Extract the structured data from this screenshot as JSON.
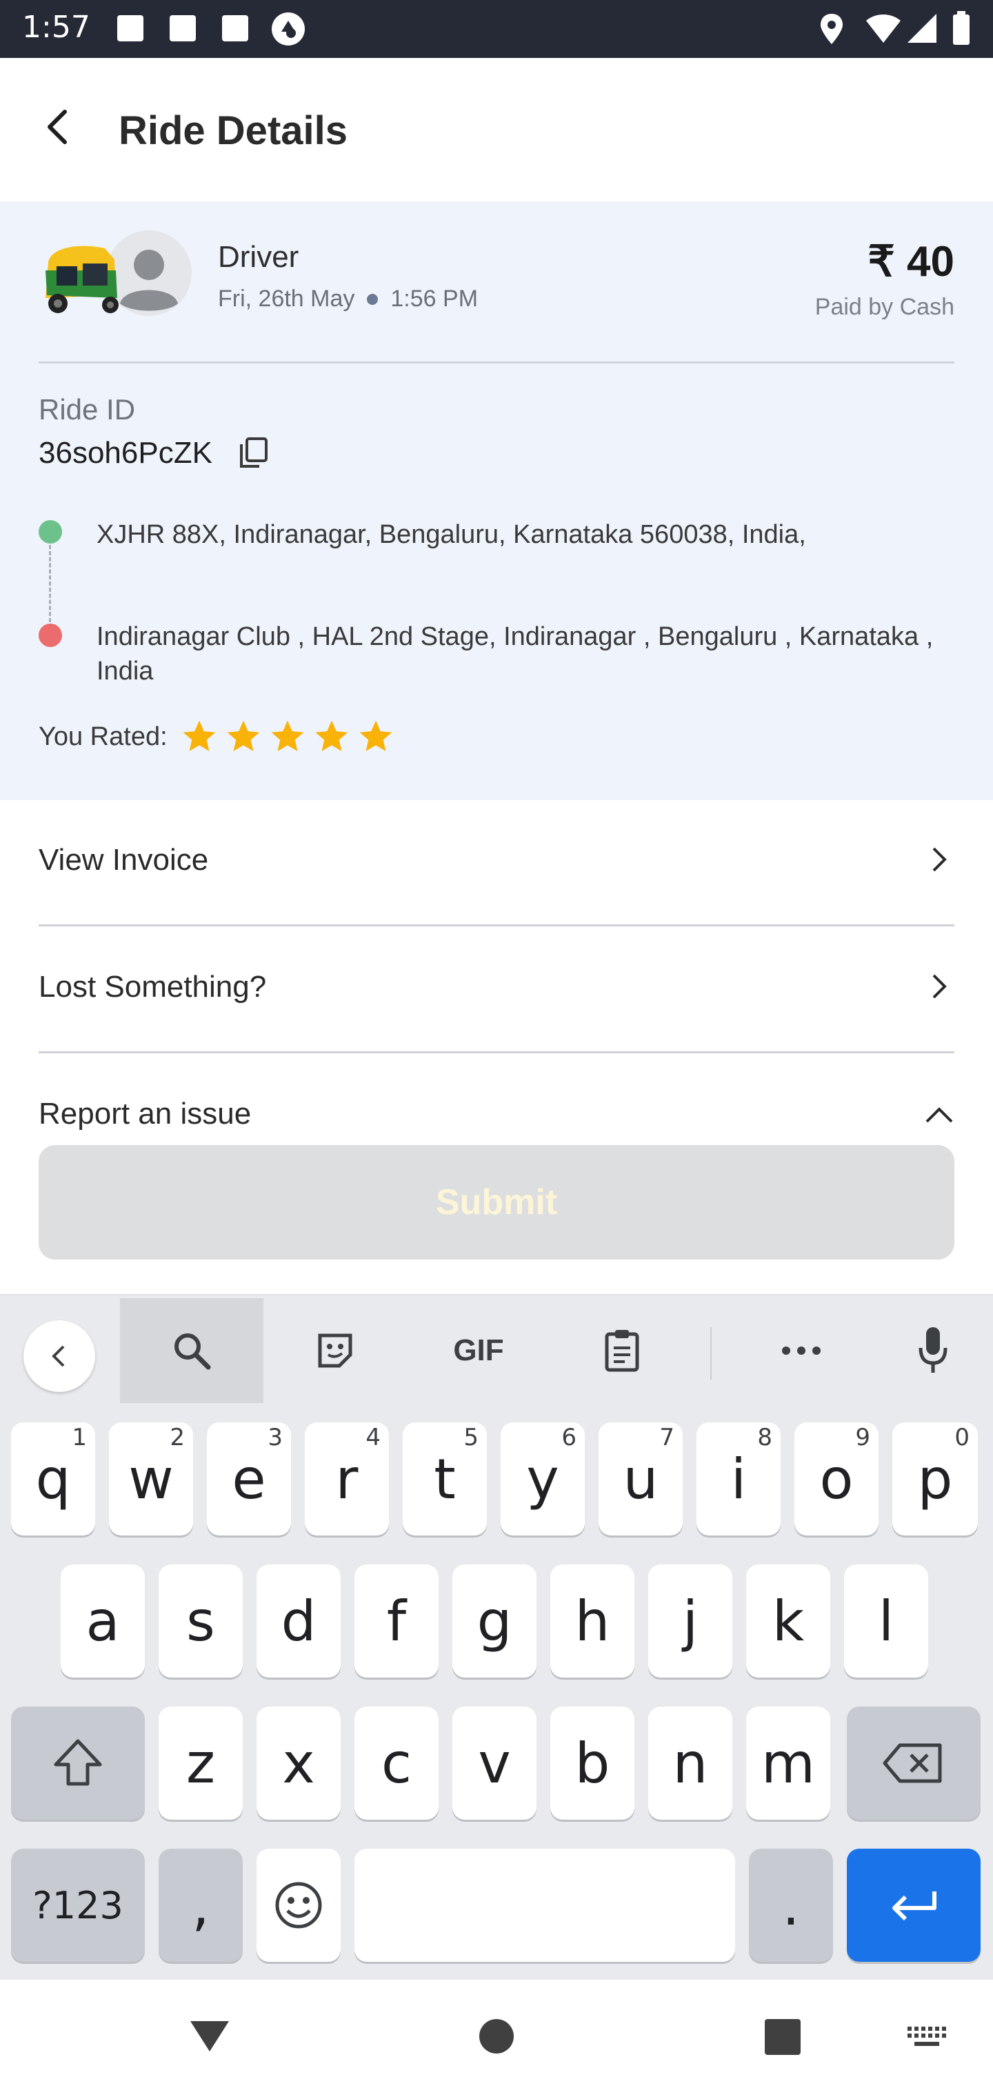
{
  "status_bar": {
    "time": "1:57",
    "left_icons": [
      "notification-square-icon",
      "notification-square-icon",
      "notification-square-icon",
      "app-circle-icon"
    ],
    "right_icons": [
      "location-icon",
      "wifi-icon",
      "signal-icon",
      "battery-icon"
    ]
  },
  "header": {
    "title": "Ride Details",
    "back_icon": "back-arrow-icon"
  },
  "ride": {
    "vehicle_icon": "auto-rickshaw-icon",
    "avatar_icon": "person-avatar-icon",
    "driver_label": "Driver",
    "date": "Fri, 26th May",
    "time": "1:56 PM",
    "fare": "₹ 40",
    "payment": "Paid by Cash",
    "ride_id_label": "Ride ID",
    "ride_id": "36soh6PcZK",
    "pickup": "XJHR 88X, Indiranagar, Bengaluru, Karnataka 560038, India,",
    "drop": "Indiranagar Club , HAL 2nd Stage, Indiranagar , Bengaluru , Karnataka , India",
    "rated_label": "You Rated:",
    "rating": 5,
    "star_color": "#f9b208"
  },
  "menu": {
    "view_invoice": "View Invoice",
    "lost_something": "Lost Something?",
    "report_issue": "Report an issue"
  },
  "submit_label": "Submit",
  "keyboard": {
    "toolbar_icons": [
      "collapse-icon",
      "search-icon",
      "sticker-icon",
      "gif-icon",
      "clipboard-icon",
      "more-icon",
      "mic-icon"
    ],
    "gif_label": "GIF",
    "row1": [
      "q",
      "w",
      "e",
      "r",
      "t",
      "y",
      "u",
      "i",
      "o",
      "p"
    ],
    "row1_hints": [
      "1",
      "2",
      "3",
      "4",
      "5",
      "6",
      "7",
      "8",
      "9",
      "0"
    ],
    "row2": [
      "a",
      "s",
      "d",
      "f",
      "g",
      "h",
      "j",
      "k",
      "l"
    ],
    "row3": [
      "z",
      "x",
      "c",
      "v",
      "b",
      "n",
      "m"
    ],
    "symbols_label": "?123",
    "comma": ",",
    "period": ".",
    "accent_color": "#1a73e8"
  },
  "nav_bar": {
    "icons": [
      "back-triangle-icon",
      "home-circle-icon",
      "recents-square-icon",
      "keyboard-switch-icon"
    ]
  }
}
